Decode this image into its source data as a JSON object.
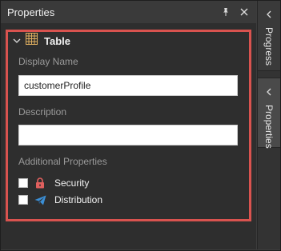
{
  "panel": {
    "title": "Properties"
  },
  "side_tabs": [
    {
      "label": "Progress"
    },
    {
      "label": "Properties"
    }
  ],
  "section": {
    "title": "Table",
    "icon": "table-grid-icon"
  },
  "fields": {
    "display_name_label": "Display Name",
    "display_name_value": "customerProfile",
    "description_label": "Description",
    "description_value": "",
    "additional_label": "Additional Properties"
  },
  "checkboxes": [
    {
      "label": "Security",
      "icon": "lock-icon",
      "checked": false
    },
    {
      "label": "Distribution",
      "icon": "paper-plane-icon",
      "checked": false
    }
  ],
  "colors": {
    "highlight": "#d9534f",
    "lock": "#e0605e",
    "plane": "#3b8fd6",
    "grid_icon": "#e0b060"
  }
}
